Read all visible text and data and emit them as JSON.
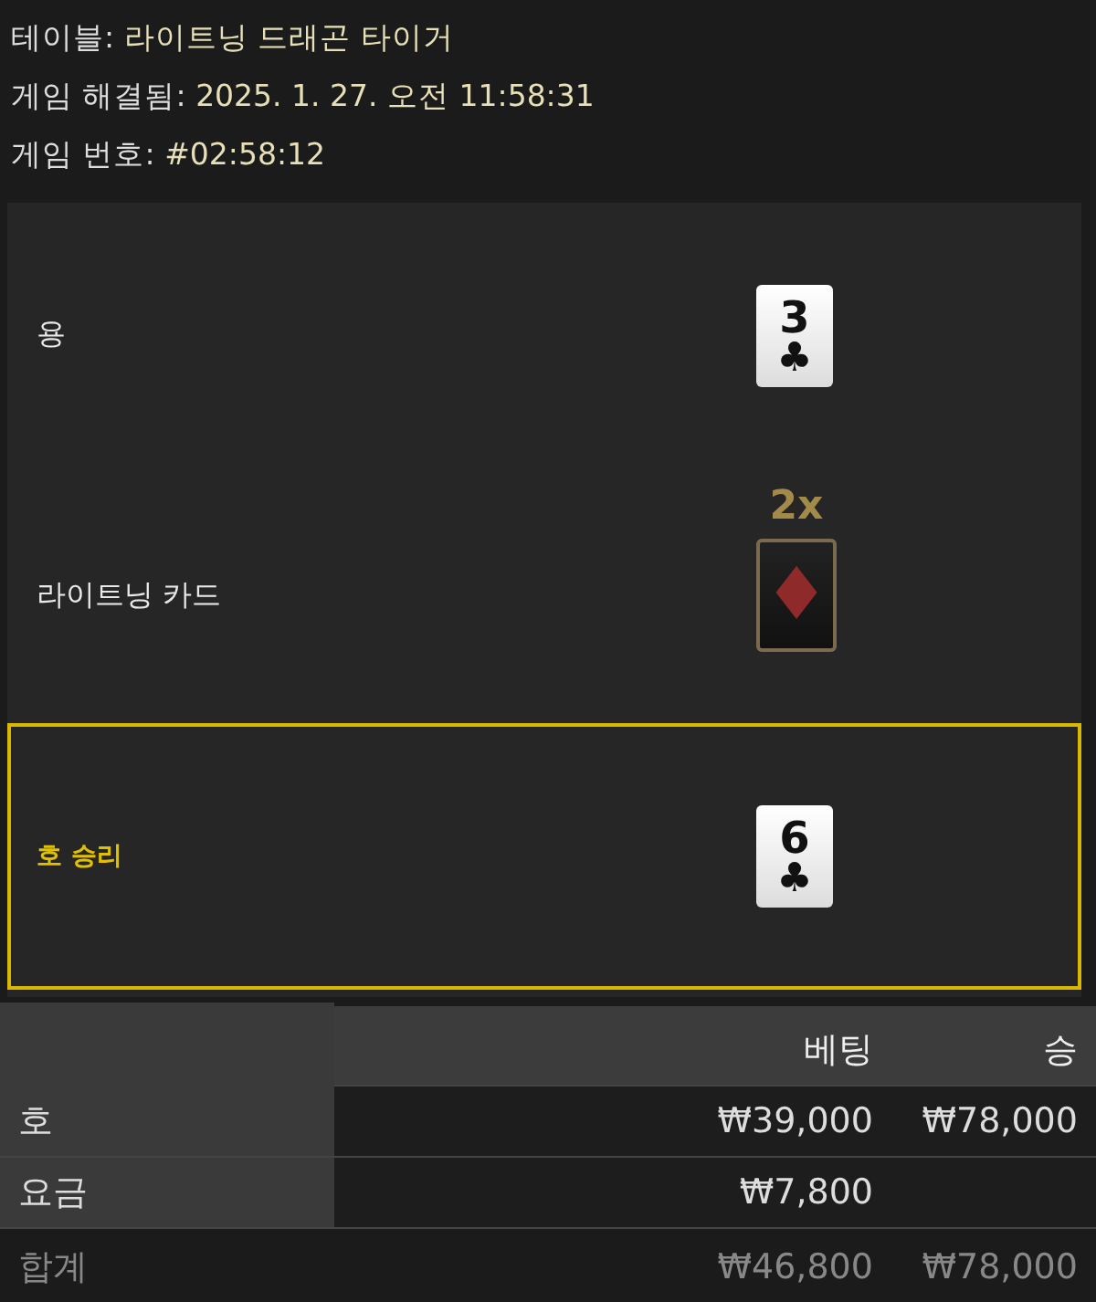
{
  "info": [
    {
      "label": "테이블:",
      "value": "라이트닝 드래곤 타이거"
    },
    {
      "label": "게임 해결됨:",
      "value": "2025. 1. 27. 오전 11:58:31"
    },
    {
      "label": "게임 번호:",
      "value": "#02:58:12"
    }
  ],
  "hands": [
    {
      "kind": "card",
      "name": "용",
      "selected": false,
      "rank": "3",
      "suit": "♣",
      "color": "#111111"
    },
    {
      "kind": "lightning",
      "name": "라이트닝 카드",
      "selected": false,
      "multiplier": "2x",
      "suit": "♦",
      "color": "#8e2a2a"
    },
    {
      "kind": "card",
      "name": "호 승리",
      "selected": true,
      "rank": "6",
      "suit": "♣",
      "color": "#111111"
    }
  ],
  "table": {
    "columns": [
      "베팅",
      "승"
    ],
    "rows": [
      {
        "label": "호",
        "bet": "₩39,000",
        "win": "₩78,000"
      },
      {
        "label": "요금",
        "bet": "₩7,800"
      }
    ],
    "total": {
      "label": "합계",
      "bet": "₩46,800",
      "win": "₩78,000"
    }
  }
}
